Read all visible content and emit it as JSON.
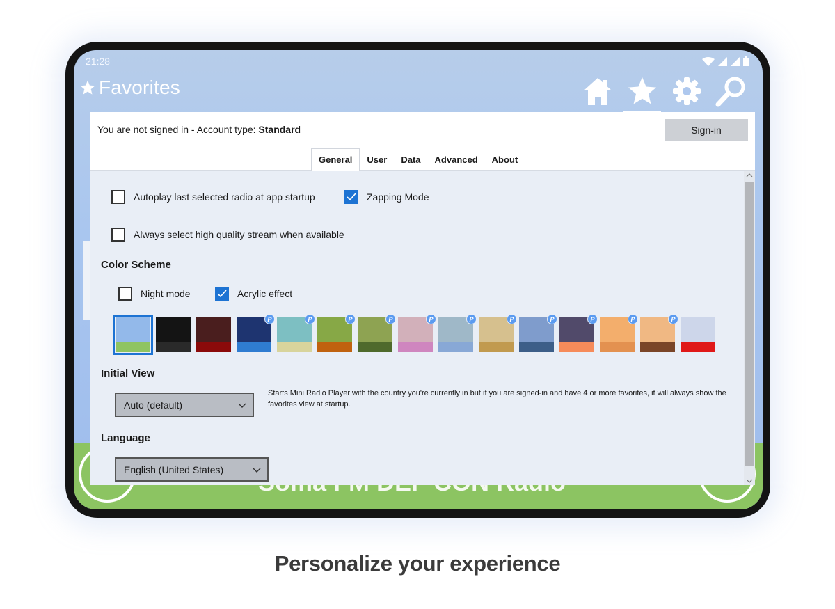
{
  "status": {
    "time": "21:28"
  },
  "app": {
    "title": "Favorites",
    "title_icon": "star-icon"
  },
  "nav": [
    {
      "name": "home",
      "icon": "home-icon",
      "active": false
    },
    {
      "name": "favorites",
      "icon": "star-icon",
      "active": true
    },
    {
      "name": "settings",
      "icon": "gear-icon",
      "active": false
    },
    {
      "name": "search",
      "icon": "search-icon",
      "active": false
    }
  ],
  "background": {
    "now_playing": "Soma FM DEF CON Radio"
  },
  "account": {
    "prefix": "You are not signed in - Account type: ",
    "type": "Standard",
    "signin_label": "Sign-in"
  },
  "tabs": [
    "General",
    "User",
    "Data",
    "Advanced",
    "About"
  ],
  "active_tab": "General",
  "general": {
    "autoplay": {
      "label": "Autoplay last selected radio at app startup",
      "checked": false
    },
    "zapping": {
      "label": "Zapping Mode",
      "checked": true
    },
    "high_quality": {
      "label": "Always select high quality stream when available",
      "checked": false
    },
    "color_scheme": {
      "title": "Color Scheme",
      "night_mode": {
        "label": "Night mode",
        "checked": false
      },
      "acrylic": {
        "label": "Acrylic effect",
        "checked": true
      },
      "premium_badge": "P",
      "swatches": [
        {
          "top": "#93b9ea",
          "bottom": "#8fc462",
          "premium": false,
          "selected": true
        },
        {
          "top": "#141414",
          "bottom": "#2a2a2a",
          "premium": false,
          "selected": false
        },
        {
          "top": "#4a1e1e",
          "bottom": "#8b0a0a",
          "premium": false,
          "selected": false
        },
        {
          "top": "#1e3470",
          "bottom": "#2f7cd1",
          "premium": true,
          "selected": false
        },
        {
          "top": "#7dbfc2",
          "bottom": "#d8d49c",
          "premium": true,
          "selected": false
        },
        {
          "top": "#87a846",
          "bottom": "#c0620f",
          "premium": true,
          "selected": false
        },
        {
          "top": "#8ea352",
          "bottom": "#4f6a2c",
          "premium": true,
          "selected": false
        },
        {
          "top": "#d2b0ba",
          "bottom": "#cf86bf",
          "premium": true,
          "selected": false
        },
        {
          "top": "#9fb8c8",
          "bottom": "#88a8d6",
          "premium": true,
          "selected": false
        },
        {
          "top": "#d6c08e",
          "bottom": "#c19a4f",
          "premium": true,
          "selected": false
        },
        {
          "top": "#7f9ccc",
          "bottom": "#3d5e88",
          "premium": true,
          "selected": false
        },
        {
          "top": "#514a6a",
          "bottom": "#f68b5a",
          "premium": true,
          "selected": false
        },
        {
          "top": "#f3ae6c",
          "bottom": "#e39150",
          "premium": true,
          "selected": false
        },
        {
          "top": "#f0b883",
          "bottom": "#7a4528",
          "premium": true,
          "selected": false
        },
        {
          "top": "#cdd6ea",
          "bottom": "#e01818",
          "premium": false,
          "selected": false
        }
      ]
    },
    "initial_view": {
      "title": "Initial View",
      "value": "Auto (default)",
      "description": "Starts Mini Radio Player with the country you're currently in but if you are signed-in and have 4 or more favorites, it will always show the favorites view at startup."
    },
    "language": {
      "title": "Language",
      "value": "English (United States)"
    }
  },
  "caption": "Personalize your experience"
}
